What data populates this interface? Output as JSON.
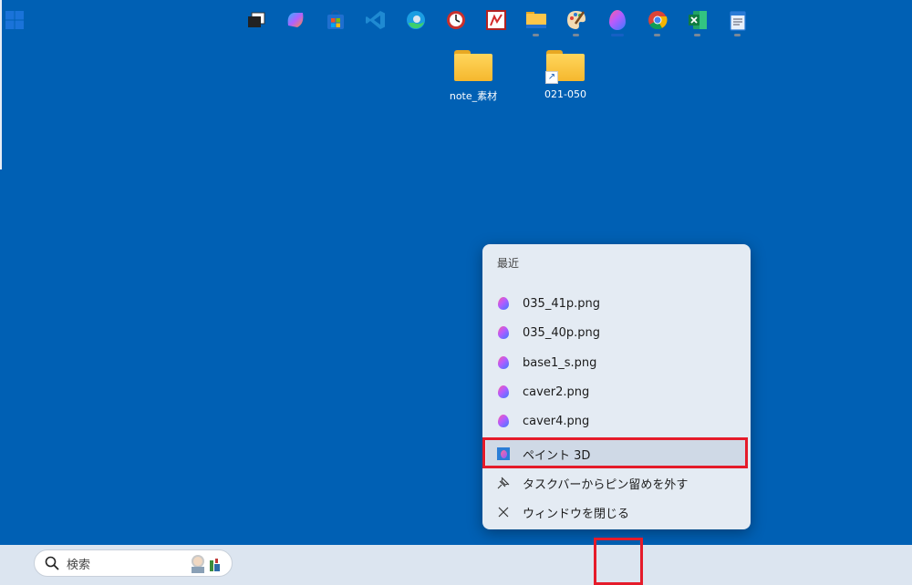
{
  "desktop": {
    "icons": [
      {
        "label": "note_素材",
        "shortcut": false
      },
      {
        "label": "021-050",
        "shortcut": true
      }
    ]
  },
  "jumplist": {
    "section_header": "最近",
    "recent": [
      {
        "label": "035_41p.png"
      },
      {
        "label": "035_40p.png"
      },
      {
        "label": "base1_s.png"
      },
      {
        "label": "caver2.png"
      },
      {
        "label": "caver4.png"
      }
    ],
    "app": {
      "label": "ペイント 3D",
      "highlighted": true
    },
    "unpin": {
      "label": "タスクバーからピン留めを外す",
      "icon": "unpin-icon"
    },
    "close": {
      "label": "ウィンドウを閉じる",
      "icon": "close-icon"
    }
  },
  "taskbar": {
    "search_placeholder": "検索",
    "apps": [
      {
        "name": "task-view",
        "running": false
      },
      {
        "name": "copilot",
        "running": false
      },
      {
        "name": "microsoft-store",
        "running": false
      },
      {
        "name": "vs-code",
        "running": false
      },
      {
        "name": "edge",
        "running": false
      },
      {
        "name": "screenpresso",
        "running": false
      },
      {
        "name": "pdf-app",
        "running": false
      },
      {
        "name": "file-explorer",
        "running": true
      },
      {
        "name": "paint",
        "running": true
      },
      {
        "name": "paint-3d",
        "running": true,
        "active": true,
        "highlighted": true
      },
      {
        "name": "chrome",
        "running": true
      },
      {
        "name": "excel",
        "running": true
      },
      {
        "name": "notepad",
        "running": true
      }
    ]
  },
  "colors": {
    "desktop": "#0060b4",
    "highlight": "#e51b2a",
    "menu": "#e4ebf3"
  }
}
